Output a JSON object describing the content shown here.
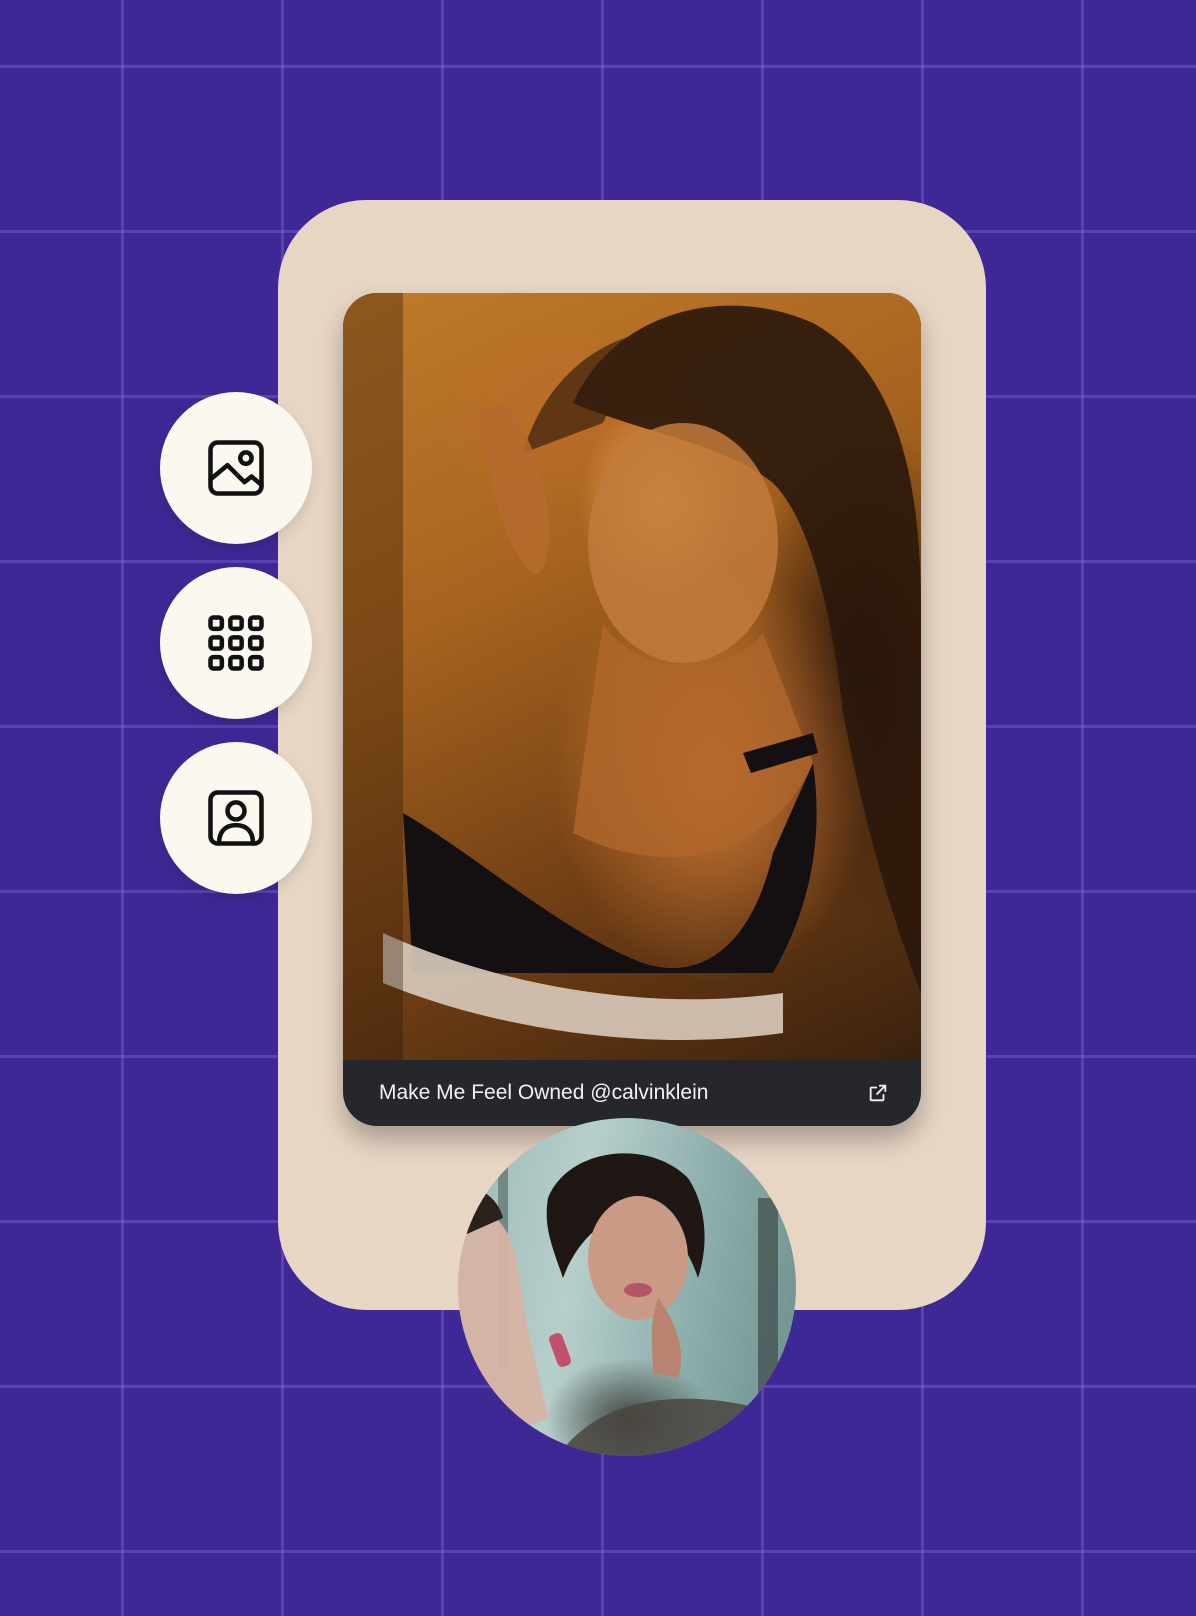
{
  "side_buttons": [
    {
      "icon": "image-icon"
    },
    {
      "icon": "grid-icon"
    },
    {
      "icon": "portrait-icon"
    }
  ],
  "card": {
    "caption": "Make Me Feel Owned @calvinklein",
    "link_icon": "external-link-icon"
  },
  "colors": {
    "background": "#3f2896",
    "panel": "#e8d6c5",
    "button": "#fbf8f0",
    "caption_bar": "#25272c"
  }
}
